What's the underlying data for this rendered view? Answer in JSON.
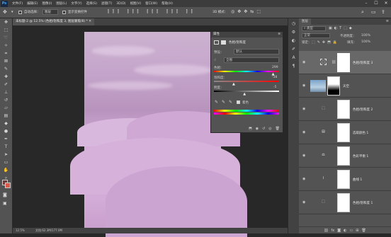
{
  "menubar": {
    "app_logo": "Ps",
    "items": [
      "文件(F)",
      "编辑(E)",
      "图像(I)",
      "图层(L)",
      "文字(Y)",
      "选择(S)",
      "滤镜(T)",
      "3D(D)",
      "视图(V)",
      "窗口(W)",
      "帮助(H)"
    ],
    "window_controls": [
      "–",
      "☐",
      "✕"
    ]
  },
  "options": {
    "auto_select_label": "自动选择：",
    "auto_select_value": "图层",
    "transform_label": "显示变换控件"
  },
  "document": {
    "tab_title": "未标题-2 @ 12.5% (色相/饱和度 3, 图层蒙版/8) *",
    "zoom": "12.5%",
    "doc_info": "文档:62.3M/177.0M"
  },
  "properties": {
    "header": "属性",
    "type_label": "色相/饱和度",
    "preset_label": "预设：",
    "preset_value": "默认",
    "channel_value": "全图",
    "hue_label": "色相：",
    "hue_value": "299",
    "saturation_label": "饱和度：",
    "saturation_value": "-38",
    "lightness_label": "明度：",
    "lightness_value": "-5",
    "colorize_label": "着色",
    "hue_position": 0.915,
    "saturation_position": 0.31,
    "lightness_position": 0.475
  },
  "layers": {
    "tab": "图层",
    "kind_label": "类型",
    "blend_mode": "正常",
    "opacity_label": "不透明度：",
    "opacity_value": "100%",
    "lock_label": "锁定：",
    "fill_label": "填充：",
    "fill_value": "100%",
    "rows": [
      {
        "name": "色相/饱和度 3",
        "icon": "adjustment-icon"
      },
      {
        "name": "天空",
        "icon": "image-icon"
      },
      {
        "name": "色相/饱和度 2",
        "icon": "adjustment-icon"
      },
      {
        "name": "选取颜色 1",
        "icon": "adjustment-icon"
      },
      {
        "name": "色彩平衡 1",
        "icon": "adjustment-icon"
      },
      {
        "name": "曲线 1",
        "icon": "adjustment-icon"
      },
      {
        "name": "色相/饱和度 1",
        "icon": "adjustment-icon"
      }
    ]
  },
  "colors": {
    "accent": "#31a8ff",
    "panel": "#535353",
    "canvas_bg": "#282828"
  }
}
